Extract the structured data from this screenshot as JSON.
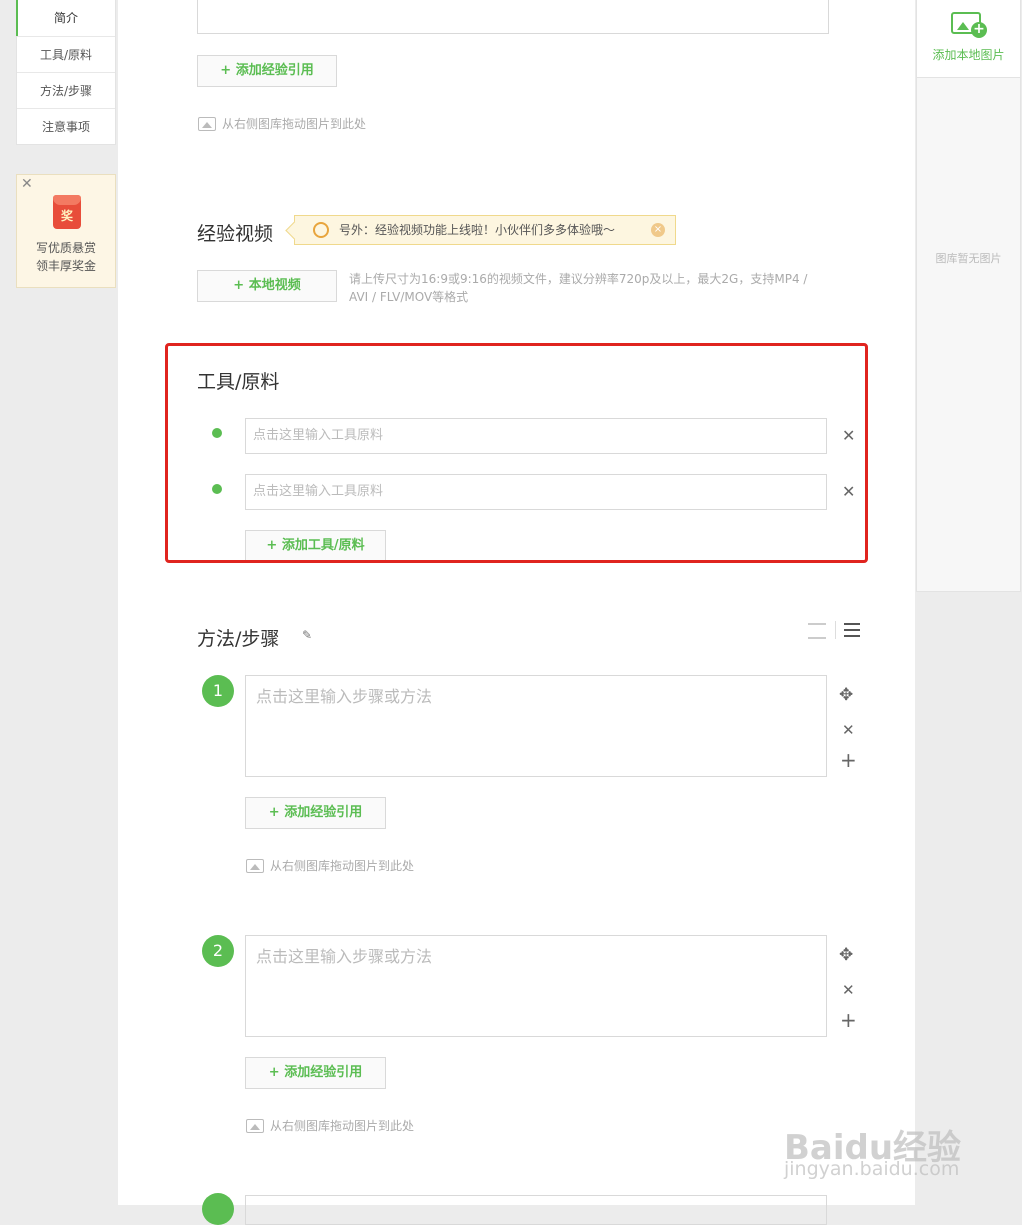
{
  "left_nav": {
    "items": [
      {
        "label": "简介"
      },
      {
        "label": "工具/原料"
      },
      {
        "label": "方法/步骤"
      },
      {
        "label": "注意事项"
      }
    ]
  },
  "reward": {
    "close_glyph": "✕",
    "badge": "奖",
    "line1": "写优质悬赏",
    "line2": "领丰厚奖金"
  },
  "intro": {
    "add_reference": "+ 添加经验引用",
    "drag_hint": "从右侧图库拖动图片到此处"
  },
  "video": {
    "title": "经验视频",
    "notice": "号外：经验视频功能上线啦！小伙伴们多多体验哦～",
    "notice_close": "×",
    "upload_button": "+ 本地视频",
    "upload_hint": "请上传尺寸为16:9或9:16的视频文件，建议分辨率720p及以上，最大2G，支持MP4 / AVI / FLV/MOV等格式"
  },
  "tools": {
    "title": "工具/原料",
    "fields": [
      {
        "placeholder": "点击这里输入工具原料"
      },
      {
        "placeholder": "点击这里输入工具原料"
      }
    ],
    "remove_glyph": "✕",
    "add_button": "+ 添加工具/原料"
  },
  "steps": {
    "title": "方法/步骤",
    "edit_icon": "pencil-icon",
    "items": [
      {
        "number": "1",
        "placeholder": "点击这里输入步骤或方法",
        "add_reference": "+ 添加经验引用",
        "drag_hint": "从右侧图库拖动图片到此处"
      },
      {
        "number": "2",
        "placeholder": "点击这里输入步骤或方法",
        "add_reference": "+ 添加经验引用",
        "drag_hint": "从右侧图库拖动图片到此处"
      }
    ],
    "move_glyph": "✥",
    "remove_glyph": "✕",
    "add_glyph": "+"
  },
  "right_panel": {
    "add_local_image": "添加本地图片",
    "empty_text": "图库暂无图片"
  },
  "watermark": {
    "brand": "Baidu经验",
    "url": "jingyan.baidu.com"
  },
  "colors": {
    "accent": "#5bbd52",
    "highlight_border": "#e0241f",
    "notice_bg": "#fdf6e0"
  }
}
